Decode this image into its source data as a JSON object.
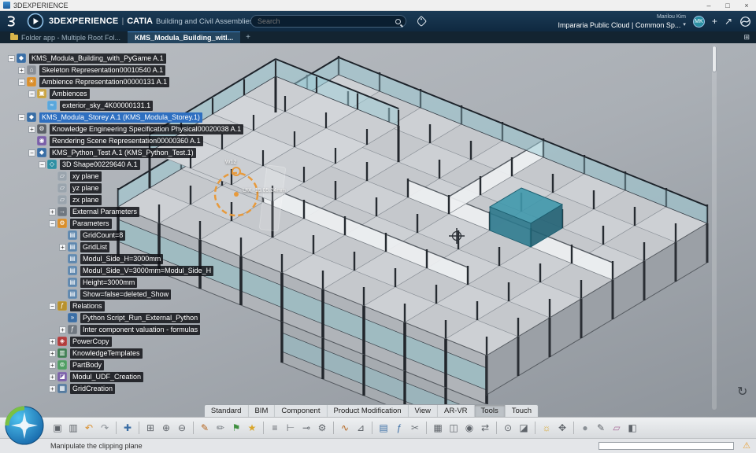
{
  "titlebar": {
    "title": "3DEXPERIENCE",
    "controls": {
      "minimize": "–",
      "maximize": "□",
      "close": "×"
    }
  },
  "appbar": {
    "brand": "3DEXPERIENCE",
    "divider": "|",
    "app": "CATIA",
    "app_desc": "Building and Civil Assemblies",
    "search_placeholder": "Search",
    "user_name": "Marilou Kim",
    "tenant": "Impararia Public Cloud | Common Sp...",
    "avatar_initials": "MK",
    "chevron": "▾",
    "add_label": "+",
    "share_label": "↗"
  },
  "tabbar": {
    "tabs": [
      {
        "label": "Folder app - Multiple Root Fol...",
        "active": false
      },
      {
        "label": "KMS_Modula_Building_witl...",
        "active": true
      }
    ],
    "new_tab": "+",
    "layout_icon": "⊞"
  },
  "tree": {
    "items": [
      {
        "d": 0,
        "e": "-",
        "i": "product",
        "t": "KMS_Modula_Building_with_PyGame A.1"
      },
      {
        "d": 1,
        "e": "+",
        "i": "skeleton",
        "t": "Skeleton Representation00010540 A.1"
      },
      {
        "d": 1,
        "e": "-",
        "i": "ambience",
        "t": "Ambience Representation00000131 A.1"
      },
      {
        "d": 2,
        "e": "-",
        "i": "folder",
        "t": "Ambiences"
      },
      {
        "d": 3,
        "e": null,
        "i": "sky",
        "t": "exterior_sky_4K00000131.1"
      },
      {
        "d": 1,
        "e": "-",
        "i": "product",
        "t": "KMS_Modula_Storey A.1 (KMS_Modula_Storey.1)",
        "sel": true
      },
      {
        "d": 2,
        "e": "+",
        "i": "knowledge",
        "t": "Knowledge Engineering Specification Physical00020038 A.1"
      },
      {
        "d": 2,
        "e": null,
        "i": "scene",
        "t": "Rendering Scene Representation00000360 A.1"
      },
      {
        "d": 2,
        "e": "-",
        "i": "product",
        "t": "KMS_Python_Test A.1 (KMS_Python_Test.1)"
      },
      {
        "d": 3,
        "e": "-",
        "i": "shape",
        "t": "3D Shape00229640 A.1"
      },
      {
        "d": 4,
        "e": null,
        "i": "plane",
        "t": "xy plane"
      },
      {
        "d": 4,
        "e": null,
        "i": "plane",
        "t": "yz plane"
      },
      {
        "d": 4,
        "e": null,
        "i": "plane",
        "t": "zx plane"
      },
      {
        "d": 4,
        "e": "+",
        "i": "extparams",
        "t": "External Parameters"
      },
      {
        "d": 4,
        "e": "-",
        "i": "params",
        "t": "Parameters"
      },
      {
        "d": 5,
        "e": null,
        "i": "param",
        "t": "GridCount=8"
      },
      {
        "d": 5,
        "e": "+",
        "i": "param",
        "t": "GridList"
      },
      {
        "d": 5,
        "e": null,
        "i": "param",
        "t": "Modul_Side_H=3000mm"
      },
      {
        "d": 5,
        "e": null,
        "i": "param",
        "t": "Modul_Side_V=3000mm=Modul_Side_H"
      },
      {
        "d": 5,
        "e": null,
        "i": "param",
        "t": "Height=3000mm"
      },
      {
        "d": 5,
        "e": null,
        "i": "param",
        "t": "Show=false=deleted_Show"
      },
      {
        "d": 4,
        "e": "-",
        "i": "relations",
        "t": "Relations"
      },
      {
        "d": 5,
        "e": null,
        "i": "script",
        "t": "Python Script_Run_External_Python"
      },
      {
        "d": 5,
        "e": "+",
        "i": "formula",
        "t": "Inter component valuation - formulas"
      },
      {
        "d": 4,
        "e": "+",
        "i": "powercopy",
        "t": "PowerCopy"
      },
      {
        "d": 4,
        "e": "+",
        "i": "ktemplates",
        "t": "KnowledgeTemplates"
      },
      {
        "d": 4,
        "e": "+",
        "i": "partbody",
        "t": "PartBody"
      },
      {
        "d": 4,
        "e": "+",
        "i": "udf",
        "t": "Modul_UDF_Creation"
      },
      {
        "d": 4,
        "e": "+",
        "i": "grid",
        "t": "GridCreation"
      }
    ]
  },
  "icon_map": {
    "product": {
      "glyph": "◆",
      "color": "#3a6ea5"
    },
    "skeleton": {
      "glyph": "⌂",
      "color": "#8a8f96"
    },
    "ambience": {
      "glyph": "☀",
      "color": "#d98e2b"
    },
    "folder": {
      "glyph": "▣",
      "color": "#c9a23d"
    },
    "sky": {
      "glyph": "≈",
      "color": "#5aa7dc"
    },
    "knowledge": {
      "glyph": "⚙",
      "color": "#5a5f66"
    },
    "scene": {
      "glyph": "◉",
      "color": "#7a5fa8"
    },
    "shape": {
      "glyph": "◇",
      "color": "#2e8fa3"
    },
    "plane": {
      "glyph": "▱",
      "color": "#9aa4ad"
    },
    "extparams": {
      "glyph": "→",
      "color": "#6f7780"
    },
    "params": {
      "glyph": "⚙",
      "color": "#d98e2b"
    },
    "param": {
      "glyph": "▤",
      "color": "#5d86ad"
    },
    "relations": {
      "glyph": "ƒ",
      "color": "#b8912e"
    },
    "script": {
      "glyph": "»",
      "color": "#3b6ea5"
    },
    "formula": {
      "glyph": "ƒ",
      "color": "#6f7780"
    },
    "powercopy": {
      "glyph": "◈",
      "color": "#b23c3c"
    },
    "ktemplates": {
      "glyph": "▥",
      "color": "#3f7d52"
    },
    "partbody": {
      "glyph": "⊚",
      "color": "#4f9d63"
    },
    "udf": {
      "glyph": "◪",
      "color": "#7a5fa8"
    },
    "grid": {
      "glyph": "▦",
      "color": "#557a9e"
    }
  },
  "viewport": {
    "annotations": {
      "robot_label": "W12",
      "measure_label": "UIX -15.05.24mm"
    }
  },
  "ribbon": {
    "tabs": [
      "Standard",
      "BIM",
      "Component",
      "Product Modification",
      "View",
      "AR-VR",
      "Tools",
      "Touch"
    ],
    "active_tab": "Tools",
    "icons": [
      {
        "name": "paste-icon",
        "glyph": "▣",
        "color": "#5f646a"
      },
      {
        "name": "copy-icon",
        "glyph": "▥",
        "color": "#5f646a"
      },
      {
        "name": "undo-icon",
        "glyph": "↶",
        "color": "#d98e2b"
      },
      {
        "name": "redo-icon",
        "glyph": "↷",
        "color": "#8a9096"
      },
      {
        "sep": true
      },
      {
        "name": "axis-icon",
        "glyph": "✚",
        "color": "#3b6ea5"
      },
      {
        "sep": true
      },
      {
        "name": "print-icon",
        "glyph": "⊞",
        "color": "#5f646a"
      },
      {
        "name": "zoom-in-icon",
        "glyph": "⊕",
        "color": "#5f646a"
      },
      {
        "name": "zoom-out-icon",
        "glyph": "⊖",
        "color": "#5f646a"
      },
      {
        "sep": true
      },
      {
        "name": "pencil-icon",
        "glyph": "✎",
        "color": "#b5651d"
      },
      {
        "name": "pen-icon",
        "glyph": "✏",
        "color": "#6f757b"
      },
      {
        "name": "flag-icon",
        "glyph": "⚑",
        "color": "#3f8f3f"
      },
      {
        "name": "star-icon",
        "glyph": "★",
        "color": "#d9a62b"
      },
      {
        "sep": true
      },
      {
        "name": "list-icon",
        "glyph": "≡",
        "color": "#5f646a"
      },
      {
        "name": "tree-icon",
        "glyph": "⊢",
        "color": "#5f646a"
      },
      {
        "name": "share-graph-icon",
        "glyph": "⊸",
        "color": "#5f646a"
      },
      {
        "name": "gear-icon",
        "glyph": "⚙",
        "color": "#5f646a"
      },
      {
        "sep": true
      },
      {
        "name": "plug-icon",
        "glyph": "∿",
        "color": "#b5651d"
      },
      {
        "name": "measure-icon",
        "glyph": "⊿",
        "color": "#5f646a"
      },
      {
        "sep": true
      },
      {
        "name": "catalog-icon",
        "glyph": "▤",
        "color": "#3b6ea5"
      },
      {
        "name": "formula-icon",
        "glyph": "ƒ",
        "color": "#3b6ea5"
      },
      {
        "name": "knife-icon",
        "glyph": "✂",
        "color": "#6f757b"
      },
      {
        "sep": true
      },
      {
        "name": "table-icon",
        "glyph": "▦",
        "color": "#5f646a"
      },
      {
        "name": "frame-icon",
        "glyph": "◫",
        "color": "#5f646a"
      },
      {
        "name": "camera-icon",
        "glyph": "◉",
        "color": "#5f646a"
      },
      {
        "name": "swap-icon",
        "glyph": "⇄",
        "color": "#5f646a"
      },
      {
        "sep": true
      },
      {
        "name": "revolve-icon",
        "glyph": "⊙",
        "color": "#5f646a"
      },
      {
        "name": "section-icon",
        "glyph": "◪",
        "color": "#5f646a"
      },
      {
        "sep": true
      },
      {
        "name": "light-icon",
        "glyph": "☼",
        "color": "#d9a62b"
      },
      {
        "name": "move-icon",
        "glyph": "✥",
        "color": "#5f646a"
      },
      {
        "sep": true
      },
      {
        "name": "sphere-icon",
        "glyph": "●",
        "color": "#8a9096"
      },
      {
        "name": "sketch-icon",
        "glyph": "✎",
        "color": "#5f646a"
      },
      {
        "name": "eraser-icon",
        "glyph": "▱",
        "color": "#a86f9a"
      },
      {
        "name": "cube-icon",
        "glyph": "◧",
        "color": "#5f646a"
      }
    ]
  },
  "statusbar": {
    "message": "Manipulate the clipping plane"
  }
}
